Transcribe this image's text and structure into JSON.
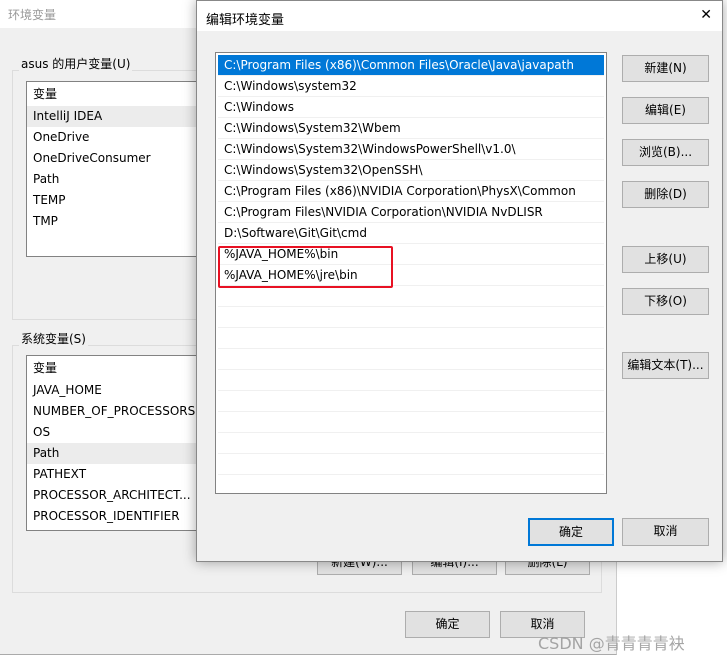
{
  "bg_window": {
    "title": "环境变量",
    "user_group": "asus 的用户变量(U)",
    "user_header": "变量",
    "user_vars": [
      "IntelliJ IDEA",
      "OneDrive",
      "OneDriveConsumer",
      "Path",
      "TEMP",
      "TMP"
    ],
    "system_group": "系统变量(S)",
    "system_header": "变量",
    "system_vars": [
      "JAVA_HOME",
      "NUMBER_OF_PROCESSORS",
      "OS",
      "Path",
      "PATHEXT",
      "PROCESSOR_ARCHITECT...",
      "PROCESSOR_IDENTIFIER"
    ],
    "sys_buttons": [
      "新建(W)...",
      "编辑(I)...",
      "删除(L)"
    ],
    "ok": "确定",
    "cancel": "取消"
  },
  "dialog": {
    "title": "编辑环境变量",
    "close": "✕",
    "paths": [
      "C:\\Program Files (x86)\\Common Files\\Oracle\\Java\\javapath",
      "C:\\Windows\\system32",
      "C:\\Windows",
      "C:\\Windows\\System32\\Wbem",
      "C:\\Windows\\System32\\WindowsPowerShell\\v1.0\\",
      "C:\\Windows\\System32\\OpenSSH\\",
      "C:\\Program Files (x86)\\NVIDIA Corporation\\PhysX\\Common",
      "C:\\Program Files\\NVIDIA Corporation\\NVIDIA NvDLISR",
      "D:\\Software\\Git\\Git\\cmd",
      "%JAVA_HOME%\\bin",
      "%JAVA_HOME%\\jre\\bin"
    ],
    "selected_index": 0,
    "highlight_color": "#e81123",
    "buttons": {
      "new": "新建(N)",
      "edit": "编辑(E)",
      "browse": "浏览(B)...",
      "delete": "删除(D)",
      "up": "上移(U)",
      "down": "下移(O)",
      "edit_text": "编辑文本(T)..."
    },
    "ok": "确定",
    "cancel": "取消"
  },
  "watermark": "CSDN @青青青青袂"
}
